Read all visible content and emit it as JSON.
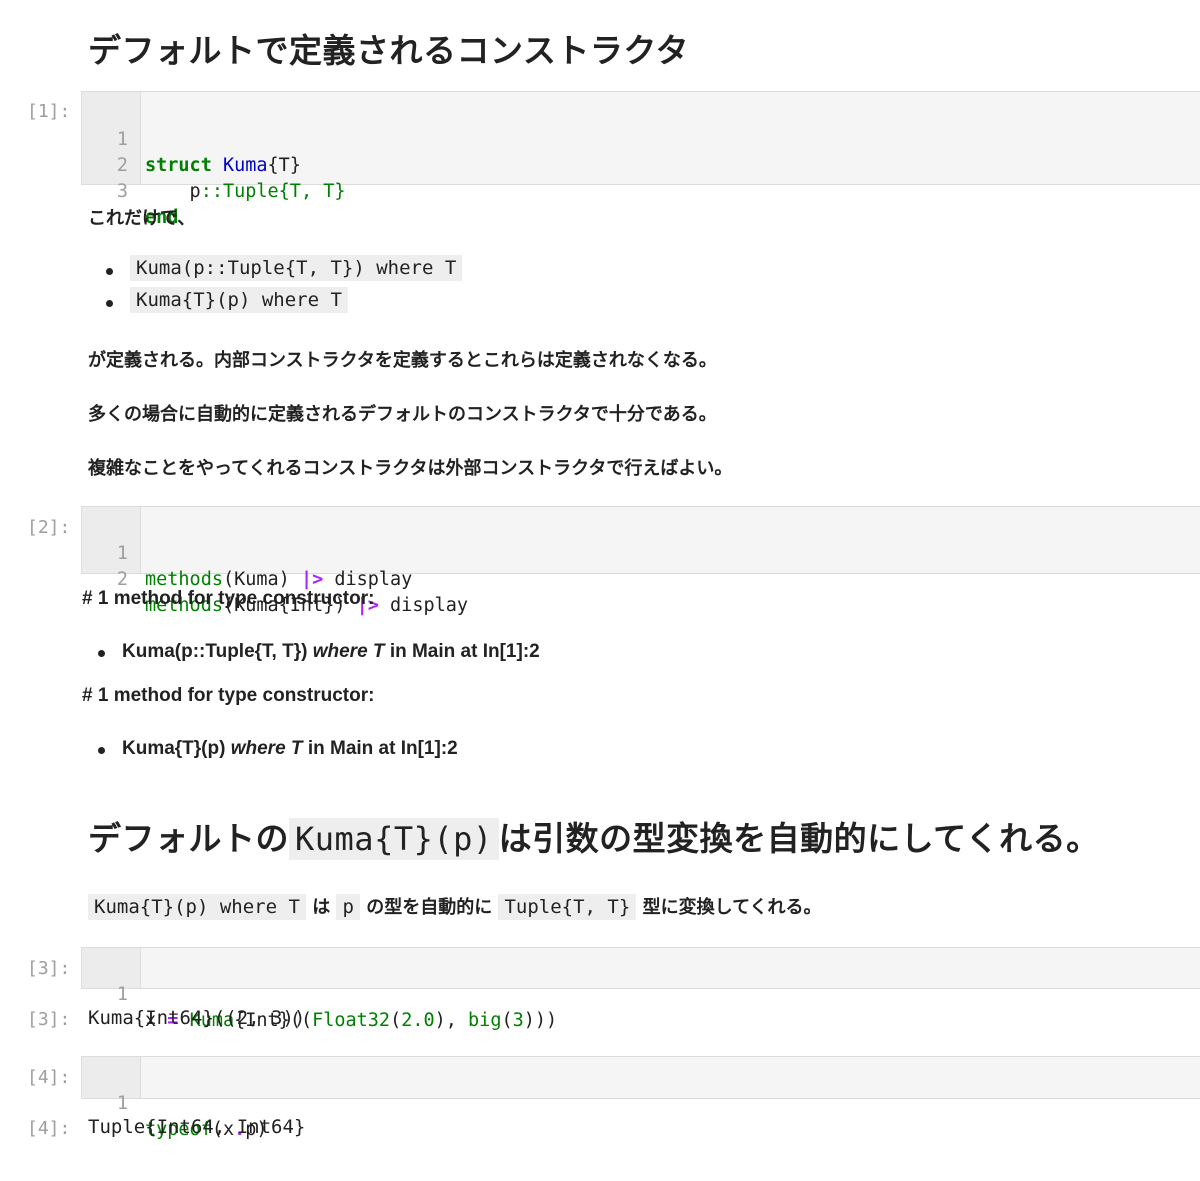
{
  "heading1": "デフォルトで定義されるコンストラクタ",
  "cell1": {
    "prompt": "[1]:",
    "lines": [
      {
        "n": "1",
        "kw": "struct",
        "ty": "Kuma",
        "rest": "{T}"
      },
      {
        "n": "2",
        "a": "    p",
        "b": "::",
        "c": "Tuple{T, T}"
      },
      {
        "n": "3",
        "kw": "end"
      }
    ]
  },
  "md1": {
    "intro": "これだけで、",
    "bullets": [
      "Kuma(p::Tuple{T, T}) where T",
      "Kuma{T}(p) where T"
    ],
    "p1": "が定義される。内部コンストラクタを定義するとこれらは定義されなくなる。",
    "p2": "多くの場合に自動的に定義されるデフォルトのコンストラクタで十分である。",
    "p3": "複雑なことをやってくれるコンストラクタは外部コンストラクタで行えばよい。"
  },
  "cell2": {
    "prompt": "[2]:",
    "lines": [
      {
        "n": "1",
        "fn": "methods",
        "args": "(Kuma) ",
        "op": "|>",
        "rest": " display"
      },
      {
        "n": "2",
        "fn": "methods",
        "args": "(Kuma{Int}) ",
        "op": "|>",
        "rest": " display"
      }
    ]
  },
  "output2": {
    "h1": "# 1 method for type constructor:",
    "item1": {
      "a": "Kuma(p::",
      "b": "Tuple{T, T}",
      "c": ")",
      "d": "where T",
      "e": "in Main at In[1]:2"
    },
    "h2": "# 1 method for type constructor:",
    "item2": {
      "a": "Kuma{T}(p)",
      "d": "where T",
      "e": "in Main at In[1]:2"
    }
  },
  "heading2": {
    "a": "デフォルトの",
    "code": "Kuma{T}(p)",
    "b": "は引数の型変換を自動的にしてくれる。"
  },
  "md2": {
    "c1": "Kuma{T}(p) where T",
    "t1": "は",
    "c2": "p",
    "t2": "の型を自動的に",
    "c3": "Tuple{T, T}",
    "t3": "型に変換してくれる。"
  },
  "cell3": {
    "prompt": "[3]:",
    "line": {
      "n": "1",
      "a": "x ",
      "op": "=",
      "fn1": "Kuma",
      "b": "{Int}((",
      "fn2": "Float32",
      "c": "(",
      "num1": "2.0",
      "d": "), ",
      "fn3": "big",
      "e": "(",
      "num2": "3",
      "f": ")))"
    },
    "out_prompt": "[3]:",
    "output": "Kuma{Int64}((2, 3))"
  },
  "cell4": {
    "prompt": "[4]:",
    "line": {
      "n": "1",
      "fn": "typeof",
      "a": "(x",
      "op": ".",
      "b": "p)"
    },
    "out_prompt": "[4]:",
    "output": "Tuple{Int64, Int64}"
  }
}
